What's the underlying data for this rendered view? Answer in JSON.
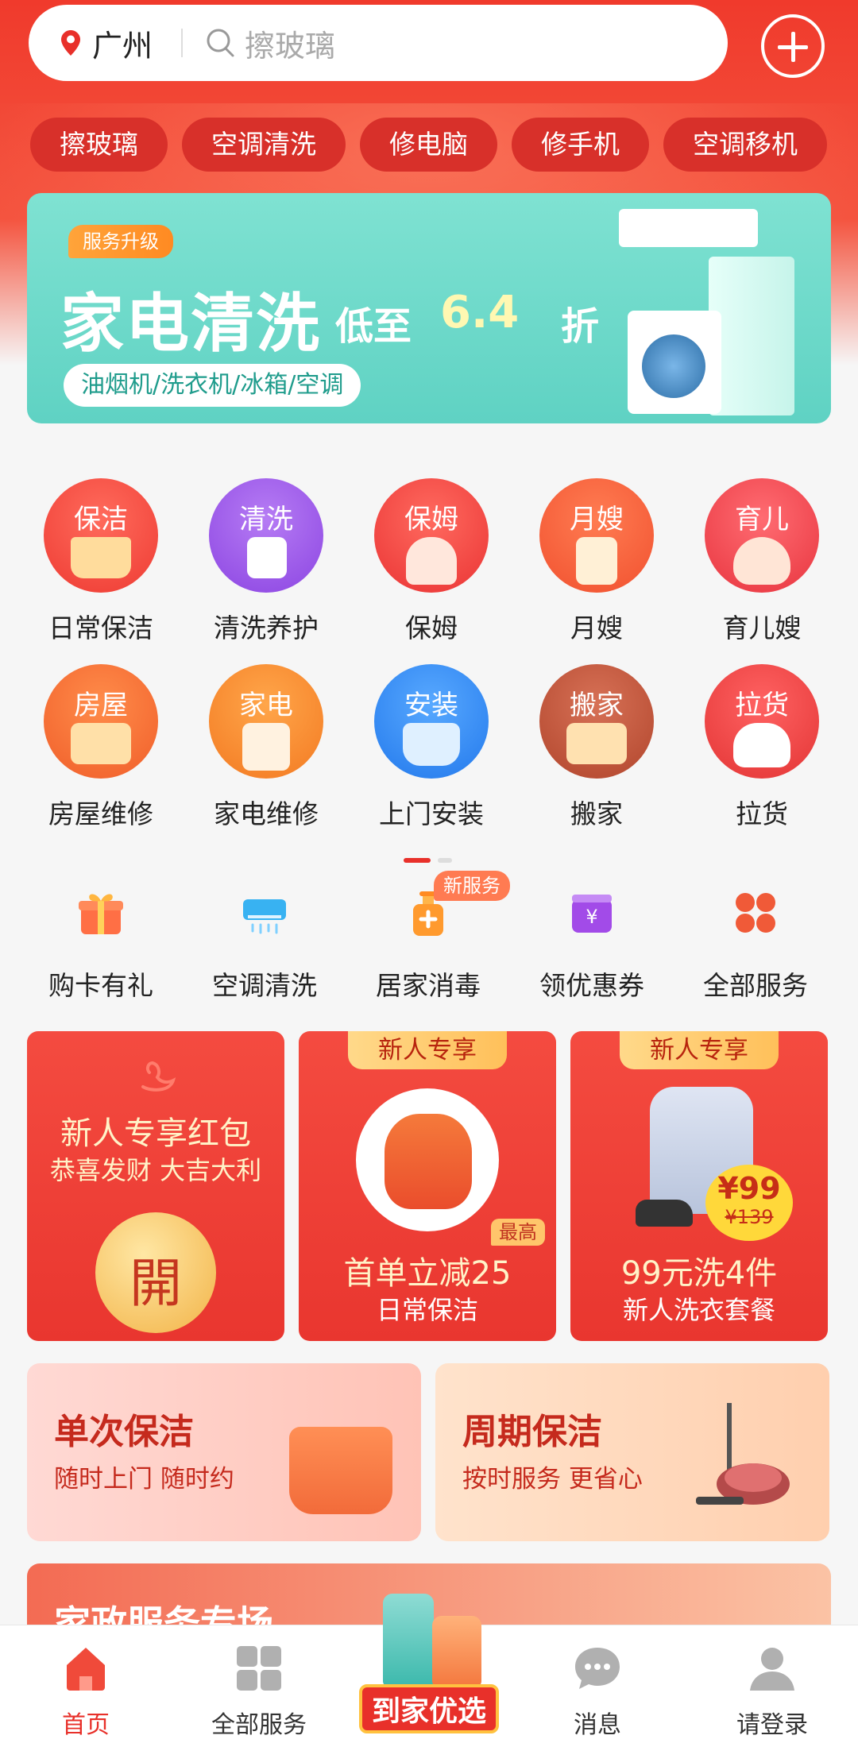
{
  "header": {
    "city": "广州",
    "search_placeholder": "擦玻璃"
  },
  "chips": [
    "擦玻璃",
    "空调清洗",
    "修电脑",
    "修手机",
    "空调移机"
  ],
  "banner": {
    "tag": "服务升级",
    "title": "家电清洗",
    "discount_prefix": "低至",
    "discount_value": "6.4",
    "discount_suffix": "折",
    "subtitle": "油烟机/洗衣机/冰箱/空调"
  },
  "services": [
    {
      "icon_text": "保洁",
      "label": "日常保洁",
      "color": "#f0413a"
    },
    {
      "icon_text": "清洗",
      "label": "清洗养护",
      "color": "#9a54e8"
    },
    {
      "icon_text": "保姆",
      "label": "保姆",
      "color": "#ef3d3a"
    },
    {
      "icon_text": "月嫂",
      "label": "月嫂",
      "color": "#f45d3a"
    },
    {
      "icon_text": "育儿",
      "label": "育儿嫂",
      "color": "#ee3f45"
    },
    {
      "icon_text": "房屋",
      "label": "房屋维修",
      "color": "#f26a33"
    },
    {
      "icon_text": "家电",
      "label": "家电维修",
      "color": "#f6872f"
    },
    {
      "icon_text": "安装",
      "label": "上门安装",
      "color": "#2a88f0"
    },
    {
      "icon_text": "搬家",
      "label": "搬家",
      "color": "#c1553a"
    },
    {
      "icon_text": "拉货",
      "label": "拉货",
      "color": "#ea3d3d"
    }
  ],
  "quick": [
    {
      "label": "购卡有礼",
      "icon": "gift-icon"
    },
    {
      "label": "空调清洗",
      "icon": "air-conditioner-icon"
    },
    {
      "label": "居家消毒",
      "icon": "sanitizer-icon",
      "badge": "新服务"
    },
    {
      "label": "领优惠券",
      "icon": "coupon-icon"
    },
    {
      "label": "全部服务",
      "icon": "all-services-icon"
    }
  ],
  "promo_cards": {
    "card1": {
      "title": "新人专享红包",
      "subtitle": "恭喜发财 大吉大利",
      "button": "開"
    },
    "card2": {
      "header": "新人专享",
      "badge": "最高",
      "title": "首单立减25",
      "subtitle": "日常保洁"
    },
    "card3": {
      "header": "新人专享",
      "price_now": "¥99",
      "price_was": "¥139",
      "title": "99元洗4件",
      "subtitle": "新人洗衣套餐"
    }
  },
  "cleaning_cards": {
    "single": {
      "title": "单次保洁",
      "subtitle": "随时上门 随时约"
    },
    "periodic": {
      "title": "周期保洁",
      "subtitle": "按时服务 更省心"
    }
  },
  "strip": {
    "title": "家政服务专场"
  },
  "tabbar": {
    "home": "首页",
    "all_services": "全部服务",
    "featured": "到家优选",
    "messages": "消息",
    "login": "请登录"
  },
  "colors": {
    "primary_red": "#f03a2c",
    "active_tab": "#e8302a"
  }
}
